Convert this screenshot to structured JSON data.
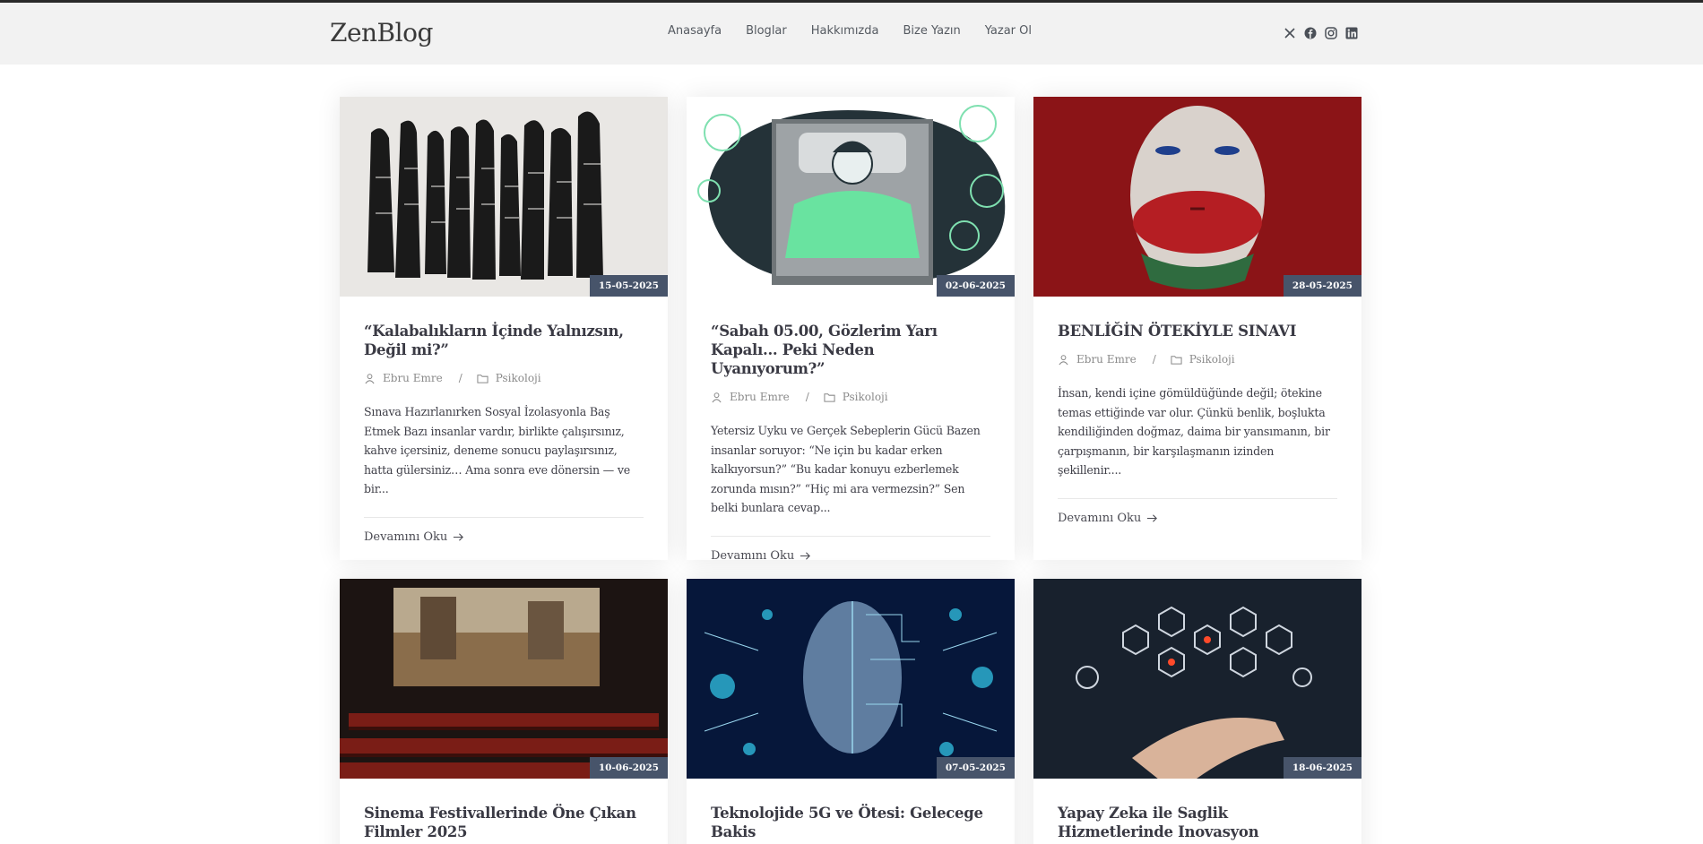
{
  "header": {
    "logo": "ZenBlog",
    "nav": [
      "Anasayfa",
      "Bloglar",
      "Hakkımızda",
      "Bize Yazın",
      "Yazar Ol"
    ],
    "social": [
      "x-icon",
      "facebook-icon",
      "instagram-icon",
      "linkedin-icon"
    ]
  },
  "posts": [
    {
      "date": "15-05-2025",
      "title": "“Kalabalıkların İçinde Yalnızsın, Değil mi?”",
      "author": "Ebru Emre",
      "category": "Psikoloji",
      "excerpt": "Sınava Hazırlanırken Sosyal İzolasyonla Baş Etmek Bazı insanlar vardır, birlikte çalışırsınız, kahve içersiniz, deneme sonucu paylaşırsınız, hatta gülersiniz… Ama sonra eve dönersin — ve bir...",
      "more": "Devamını Oku"
    },
    {
      "date": "02-06-2025",
      "title": "“Sabah 05.00, Gözlerim Yarı Kapalı... Peki Neden Uyanıyorum?”",
      "author": "Ebru Emre",
      "category": "Psikoloji",
      "excerpt": "Yetersiz Uyku ve Gerçek Sebeplerin Gücü Bazen insanlar soruyor: “Ne için bu kadar erken kalkıyorsun?” “Bu kadar konuyu ezberlemek zorunda mısın?” “Hiç mi ara vermezsin?” Sen belki bunlara cevap...",
      "more": "Devamını Oku"
    },
    {
      "date": "28-05-2025",
      "title": "BENLİĞİN ÖTEKİYLE SINAVI",
      "author": "Ebru Emre",
      "category": "Psikoloji",
      "excerpt": "İnsan, kendi içine gömüldüğünde değil; ötekine temas ettiğinde var olur. Çünkü benlik, boşlukta kendiliğinden doğmaz, daima bir yansımanın, bir çarpışmanın, bir karşılaşmanın izinden şekillenir....",
      "more": "Devamını Oku"
    },
    {
      "date": "10-06-2025",
      "title": "Sinema Festivallerinde Öne Çıkan Filmler 2025"
    },
    {
      "date": "07-05-2025",
      "title": "Teknolojide 5G ve Ötesi: Gelecege Bakis"
    },
    {
      "date": "18-06-2025",
      "title": "Yapay Zeka ile Saglik Hizmetlerinde Inovasyon"
    }
  ]
}
